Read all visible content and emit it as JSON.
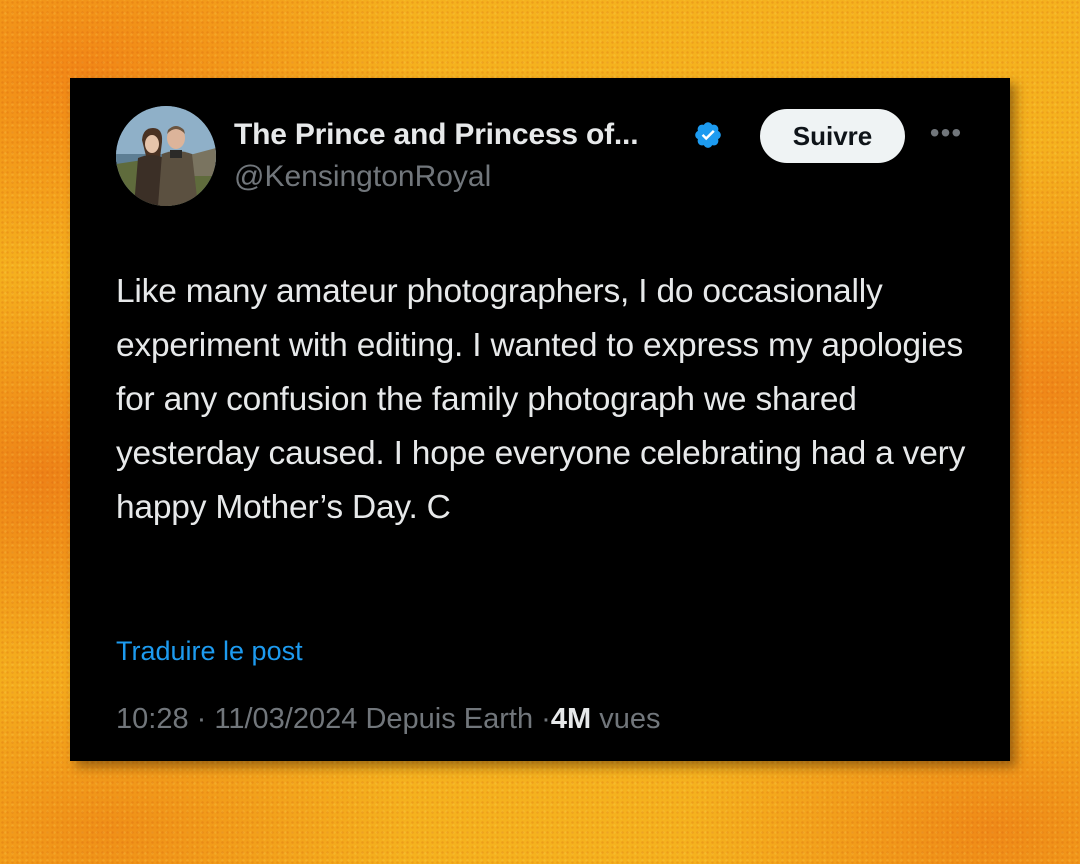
{
  "post": {
    "author": {
      "name": "The Prince and Princess of...",
      "handle": "@KensingtonRoyal",
      "verified": true,
      "avatar_icon": "profile-photo-couple"
    },
    "follow_label": "Suivre",
    "more_icon": "more-options-icon",
    "text": "Like many amateur photographers, I do occasionally experiment with editing. I wanted to express my apologies for any confusion the family photograph we shared yesterday caused. I hope everyone celebrating had a very happy Mother’s Day. C",
    "translate_label": "Traduire le post",
    "meta": {
      "time": "10:28",
      "separator": "·",
      "date": "11/03/2024",
      "source": "Depuis Earth",
      "views_count": "4M",
      "views_label": "vues"
    }
  },
  "colors": {
    "card_background": "#000000",
    "primary_text": "#e7e9ea",
    "secondary_text": "#71767b",
    "link": "#1d9bf0",
    "verified_badge": "#1d9bf0",
    "button_background": "#eff3f4",
    "page_background": "#f5b21e"
  }
}
